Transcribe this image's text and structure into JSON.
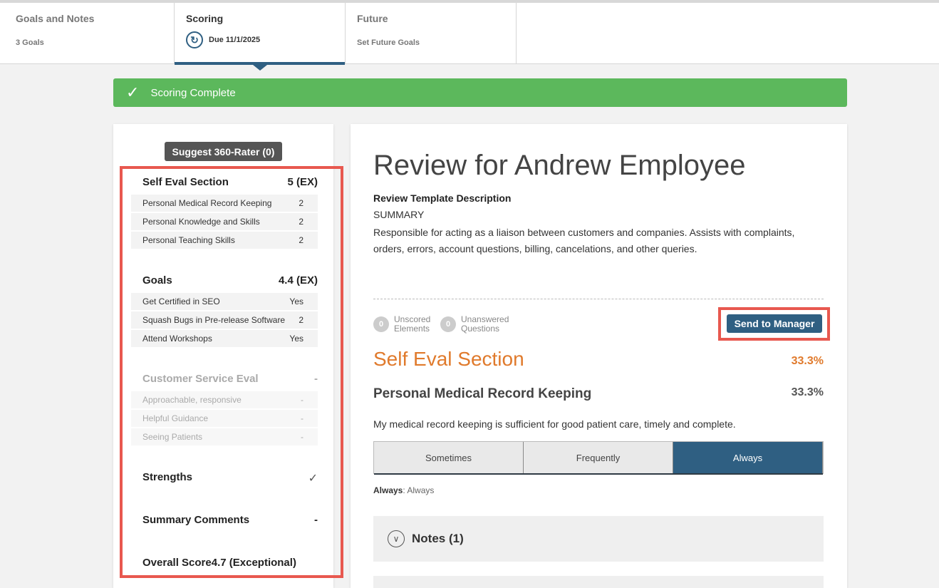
{
  "tabs": [
    {
      "title": "Goals and Notes",
      "sub": "3 Goals"
    },
    {
      "title": "Scoring",
      "sub": "Due 11/1/2025"
    },
    {
      "title": "Future",
      "sub": "Set Future Goals"
    }
  ],
  "banner": {
    "text": "Scoring Complete"
  },
  "left": {
    "rater_button": "Suggest 360-Rater (0)",
    "self_eval": {
      "title": "Self Eval Section",
      "score": "5 (EX)",
      "items": [
        {
          "label": "Personal Medical Record Keeping",
          "value": "2"
        },
        {
          "label": "Personal Knowledge and Skills",
          "value": "2"
        },
        {
          "label": "Personal Teaching Skills",
          "value": "2"
        }
      ]
    },
    "goals": {
      "title": "Goals",
      "score": "4.4 (EX)",
      "items": [
        {
          "label": "Get Certified in SEO",
          "value": "Yes"
        },
        {
          "label": "Squash Bugs in Pre-release Software",
          "value": "2"
        },
        {
          "label": "Attend Workshops",
          "value": "Yes"
        }
      ]
    },
    "customer": {
      "title": "Customer Service Eval",
      "score": "-",
      "items": [
        {
          "label": "Approachable, responsive",
          "value": "-"
        },
        {
          "label": "Helpful Guidance",
          "value": "-"
        },
        {
          "label": "Seeing Patients",
          "value": "-"
        }
      ]
    },
    "strengths": {
      "title": "Strengths",
      "icon": "checkmark-icon"
    },
    "summary_comments": {
      "title": "Summary Comments",
      "score": "-"
    },
    "overall": {
      "title": "Overall Score",
      "score": "4.7 (Exceptional)"
    }
  },
  "review": {
    "title": "Review for Andrew Employee",
    "desc_label": "Review Template Description",
    "summary_label": "SUMMARY",
    "summary_text": "Responsible for acting as a liaison between customers and companies. Assists with complaints, orders, errors, account questions, billing, cancelations, and other queries.",
    "unscored": {
      "count": "0",
      "line1": "Unscored",
      "line2": "Elements"
    },
    "unanswered": {
      "count": "0",
      "line1": "Unanswered",
      "line2": "Questions"
    },
    "send_button": "Send to Manager",
    "section_title": "Self Eval Section",
    "section_pct": "33.3%",
    "question_title": "Personal Medical Record Keeping",
    "question_pct": "33.3%",
    "question_text": "My medical record keeping is sufficient for good patient care, timely and complete.",
    "choices": [
      "Sometimes",
      "Frequently",
      "Always"
    ],
    "selected_choice": "Always",
    "answer_label": "Always",
    "answer_value": ": Always",
    "notes_label": "Notes (1)"
  },
  "colors": {
    "accent": "#2f5f82",
    "success": "#5cb85c",
    "orange": "#e07a2c",
    "highlight": "#e8584f"
  }
}
